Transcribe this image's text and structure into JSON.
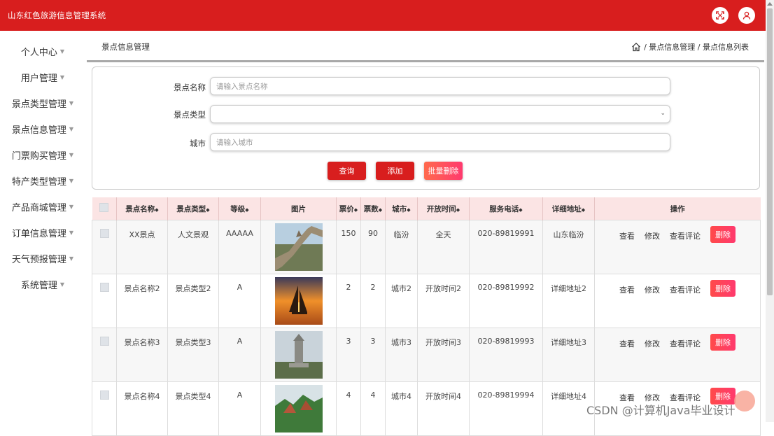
{
  "app": {
    "title": "山东红色旅游信息管理系统"
  },
  "header_icons": [
    "fullscreen-icon",
    "user-icon"
  ],
  "sidebar": {
    "items": [
      {
        "label": "个人中心"
      },
      {
        "label": "用户管理"
      },
      {
        "label": "景点类型管理"
      },
      {
        "label": "景点信息管理"
      },
      {
        "label": "门票购买管理"
      },
      {
        "label": "特产类型管理"
      },
      {
        "label": "产品商城管理"
      },
      {
        "label": "订单信息管理"
      },
      {
        "label": "天气预报管理"
      },
      {
        "label": "系统管理"
      }
    ]
  },
  "page": {
    "section_title": "景点信息管理",
    "breadcrumb": "/ 景点信息管理 / 景点信息列表"
  },
  "search": {
    "name_label": "景点名称",
    "name_placeholder": "请输入景点名称",
    "type_label": "景点类型",
    "type_value": "",
    "city_label": "城市",
    "city_placeholder": "请输入城市",
    "query_button": "查询",
    "add_button": "添加",
    "batch_delete_button": "批量删除"
  },
  "table": {
    "headers": {
      "name": "景点名称",
      "type": "景点类型",
      "level": "等级",
      "image": "图片",
      "price": "票价",
      "tickets": "票数",
      "city": "城市",
      "open_time": "开放时间",
      "phone": "服务电话",
      "address": "详细地址",
      "ops": "操作"
    },
    "ops_labels": {
      "view": "查看",
      "edit": "修改",
      "comments": "查看评论",
      "delete": "删除"
    },
    "rows": [
      {
        "name": "XX景点",
        "type": "人文景观",
        "level": "AAAAA",
        "image": "great-wall-photo",
        "price": "150",
        "tickets": "90",
        "city": "临汾",
        "open_time": "全天",
        "phone": "020-89819991",
        "address": "山东临汾"
      },
      {
        "name": "景点名称2",
        "type": "景点类型2",
        "level": "A",
        "image": "sailboat-sunset-photo",
        "price": "2",
        "tickets": "2",
        "city": "城市2",
        "open_time": "开放时间2",
        "phone": "020-89819992",
        "address": "详细地址2"
      },
      {
        "name": "景点名称3",
        "type": "景点类型3",
        "level": "A",
        "image": "monument-tower-photo",
        "price": "3",
        "tickets": "3",
        "city": "城市3",
        "open_time": "开放时间3",
        "phone": "020-89819993",
        "address": "详细地址3"
      },
      {
        "name": "景点名称4",
        "type": "景点类型4",
        "level": "A",
        "image": "mountain-cliff-photo",
        "price": "4",
        "tickets": "4",
        "city": "城市4",
        "open_time": "开放时间4",
        "phone": "020-89819994",
        "address": "详细地址4"
      }
    ]
  },
  "watermark": "CSDN @计算机Java毕业设计",
  "colors": {
    "brand_red": "#d81e1e",
    "header_pink": "#fbe4e4"
  }
}
